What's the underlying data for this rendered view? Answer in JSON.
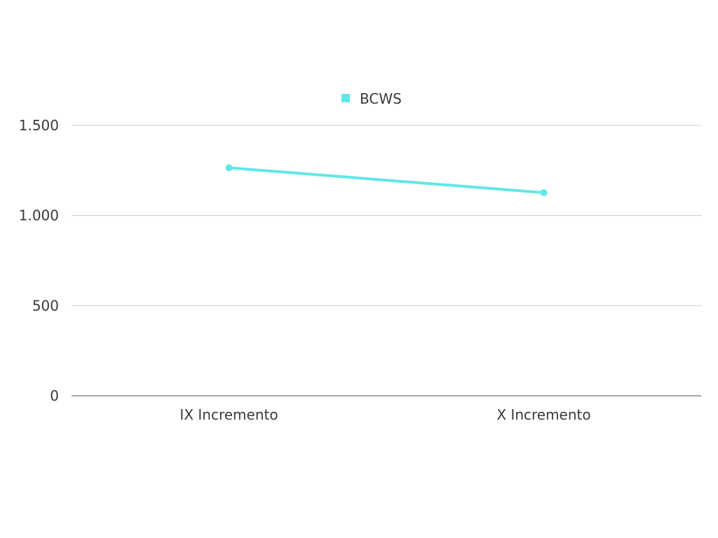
{
  "chart_data": {
    "type": "line",
    "categories": [
      "IX Incremento",
      "X Incremento"
    ],
    "series": [
      {
        "name": "BCWS",
        "values": [
          1265,
          1127
        ],
        "color": "#63e6e6"
      }
    ],
    "y_ticks": [
      0,
      500,
      1000,
      1500
    ],
    "y_tick_labels": [
      "0",
      "500",
      "1.000",
      "1.500"
    ],
    "ylim": [
      0,
      1500
    ],
    "grid": true,
    "legend": "top-center",
    "colors": {
      "grid": "#cccccc",
      "axis": "#888888",
      "text": "#3a3a3a"
    }
  }
}
